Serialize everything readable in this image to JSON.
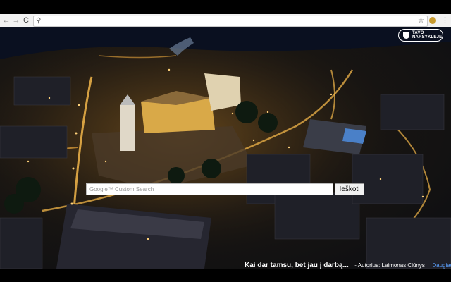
{
  "browser": {
    "back_glyph": "←",
    "forward_glyph": "→",
    "reload_glyph": "C",
    "search_glyph": "⚲",
    "star_glyph": "☆",
    "menu_glyph": "⋮"
  },
  "brand": {
    "line1": "TAVO",
    "line2": "NARSYKLEJE"
  },
  "search": {
    "placeholder": "Google™ Custom Search",
    "button_label": "Ieškoti"
  },
  "caption": {
    "text": "Kai dar tamsu, bet jau į darbą...",
    "author": "- Autorius: Laimonas Ciūnys",
    "more_link": "Daugiau..."
  },
  "colors": {
    "city_glow": "#f2b64a",
    "dark_sky": "#0b0d12",
    "link": "#5aa0ff"
  },
  "icons": [
    "back-arrow-icon",
    "forward-arrow-icon",
    "reload-icon",
    "search-icon",
    "star-icon",
    "extension-icon",
    "menu-icon",
    "shield-icon"
  ]
}
